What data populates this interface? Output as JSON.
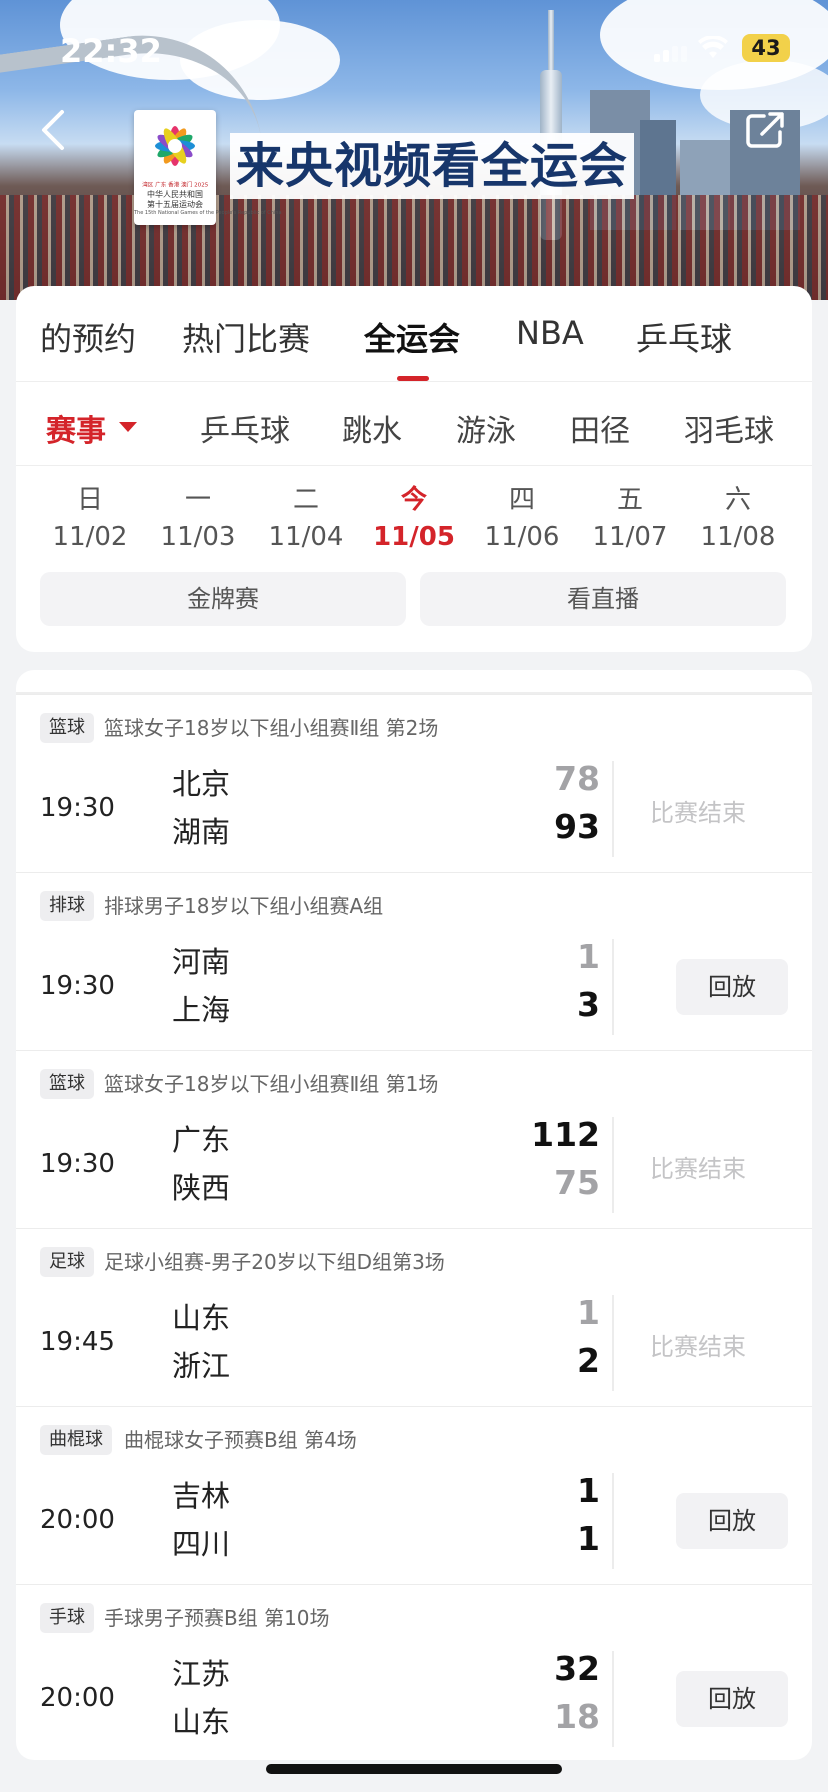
{
  "status_bar": {
    "time": "22:32",
    "battery": "43"
  },
  "header": {
    "title": "来央视频看全运会",
    "logo": {
      "line1": "湾区 广东 香港 澳门 2025",
      "line2a": "中华人民共和国",
      "line2b": "第十五届运动会",
      "line3": "The 15th National Games of the People's Republic of China"
    }
  },
  "tabs": [
    "的预约",
    "热门比赛",
    "全运会",
    "NBA",
    "乒乓球"
  ],
  "active_tab": "全运会",
  "subtabs": [
    "赛事",
    "乒乓球",
    "跳水",
    "游泳",
    "田径",
    "羽毛球"
  ],
  "days": [
    {
      "weekday": "日",
      "date": "11/02"
    },
    {
      "weekday": "一",
      "date": "11/03"
    },
    {
      "weekday": "二",
      "date": "11/04"
    },
    {
      "weekday": "今",
      "date": "11/05",
      "today": true
    },
    {
      "weekday": "四",
      "date": "11/06"
    },
    {
      "weekday": "五",
      "date": "11/07"
    },
    {
      "weekday": "六",
      "date": "11/08"
    }
  ],
  "filters": {
    "gold": "金牌赛",
    "live": "看直播"
  },
  "matches": [
    {
      "tag": "篮球",
      "event": "篮球女子18岁以下组小组赛Ⅱ组 第2场",
      "time": "19:30",
      "team1": "北京",
      "score1": "78",
      "team2": "湖南",
      "score2": "93",
      "action": "比赛结束",
      "replay": false
    },
    {
      "tag": "排球",
      "event": "排球男子18岁以下组小组赛A组",
      "time": "19:30",
      "team1": "河南",
      "score1": "1",
      "team2": "上海",
      "score2": "3",
      "action": "回放",
      "replay": true
    },
    {
      "tag": "篮球",
      "event": "篮球女子18岁以下组小组赛Ⅱ组 第1场",
      "time": "19:30",
      "team1": "广东",
      "score1": "112",
      "team2": "陕西",
      "score2": "75",
      "action": "比赛结束",
      "replay": false
    },
    {
      "tag": "足球",
      "event": "足球小组赛-男子20岁以下组D组第3场",
      "time": "19:45",
      "team1": "山东",
      "score1": "1",
      "team2": "浙江",
      "score2": "2",
      "action": "比赛结束",
      "replay": false
    },
    {
      "tag": "曲棍球",
      "event": "曲棍球女子预赛B组 第4场",
      "time": "20:00",
      "team1": "吉林",
      "score1": "1",
      "team2": "四川",
      "score2": "1",
      "action": "回放",
      "replay": true
    },
    {
      "tag": "手球",
      "event": "手球男子预赛B组 第10场",
      "time": "20:00",
      "team1": "江苏",
      "score1": "32",
      "team2": "山东",
      "score2": "18",
      "action": "回放",
      "replay": true
    }
  ],
  "colors": {
    "accent": "#d4242a",
    "title_blue": "#17366b"
  }
}
